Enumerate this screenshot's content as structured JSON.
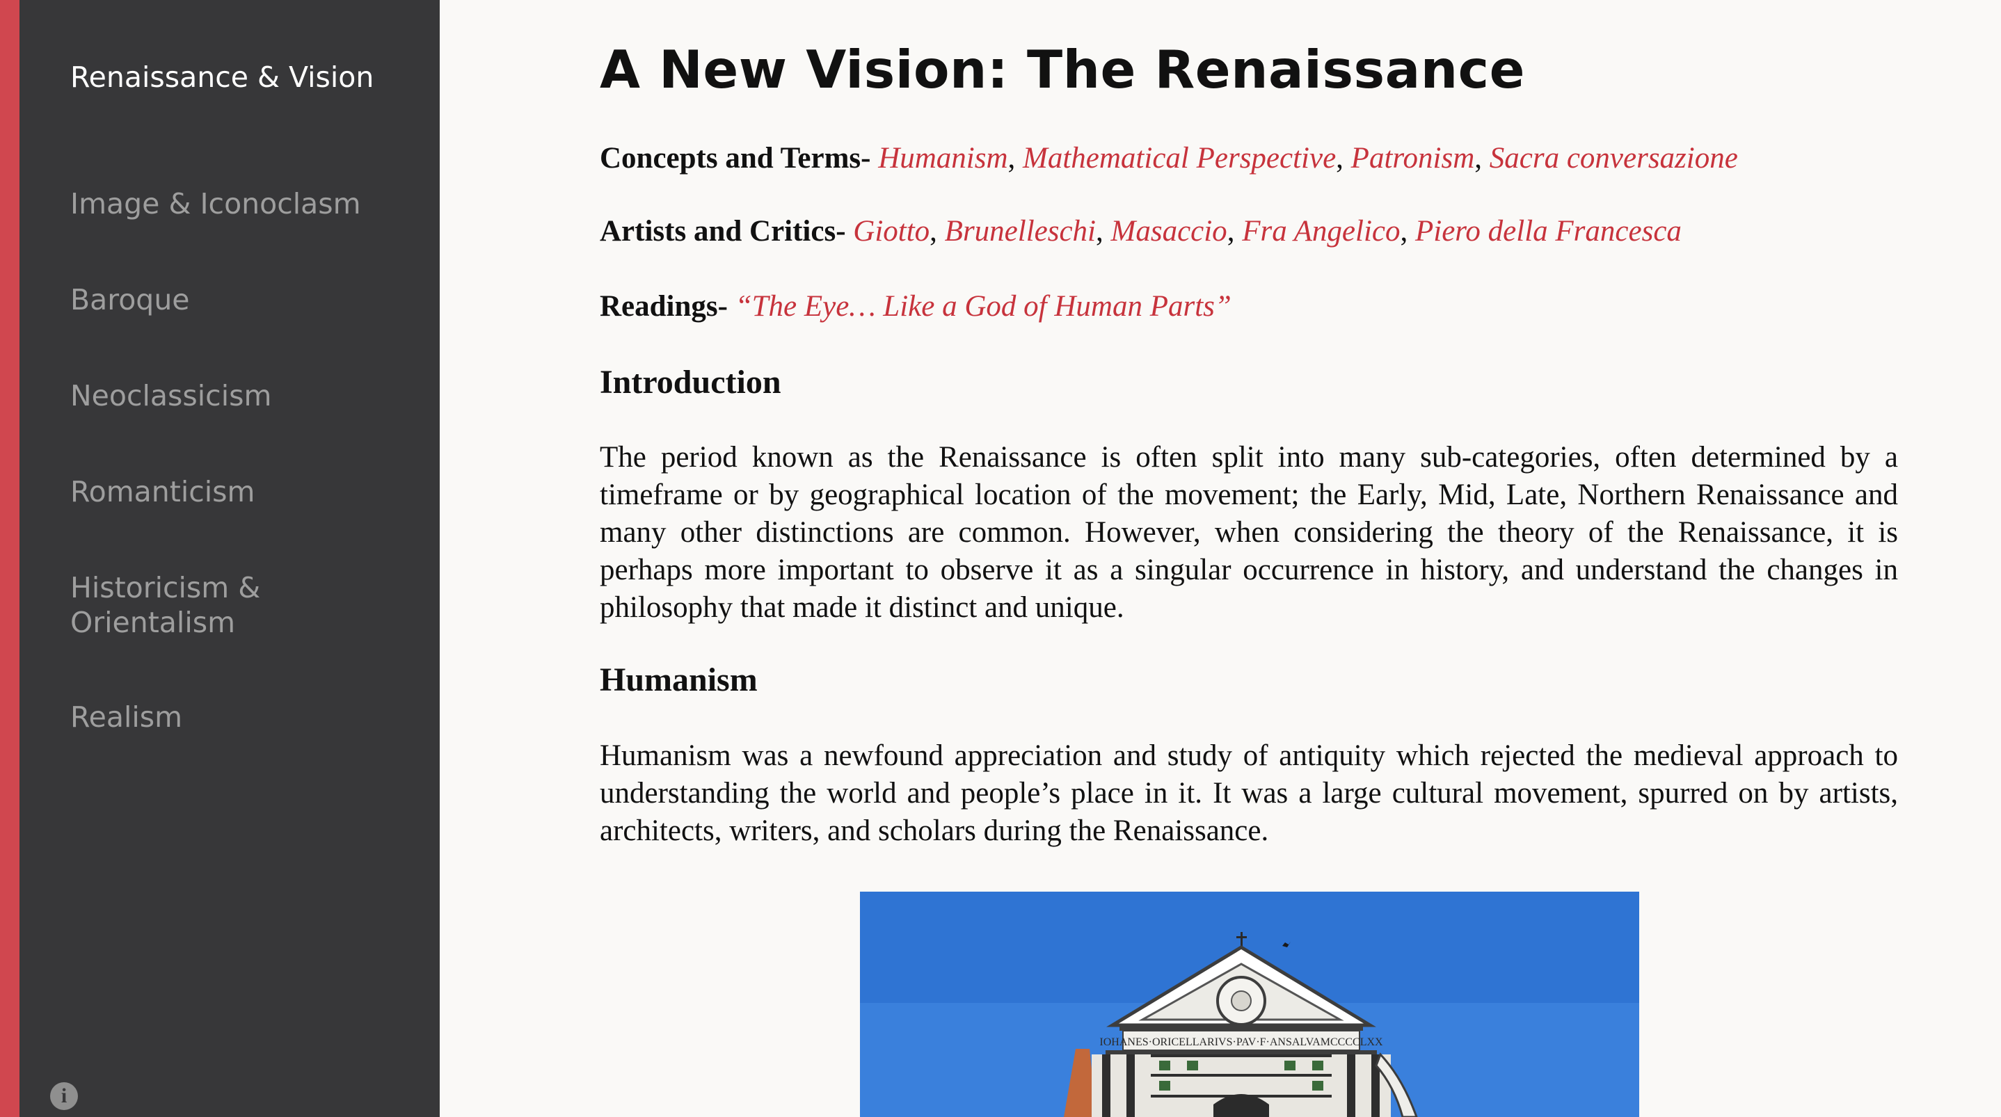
{
  "sidebar": {
    "items": [
      {
        "label": "Renaissance & Vision",
        "active": true
      },
      {
        "label": "Image & Iconoclasm"
      },
      {
        "label": "Baroque"
      },
      {
        "label": "Neoclassicism"
      },
      {
        "label": "Romanticism"
      },
      {
        "label": "Historicism &"
      },
      {
        "label": "Orientalism"
      },
      {
        "label": "Realism"
      }
    ],
    "info_icon": "info-icon"
  },
  "main": {
    "title": "A New Vision: The Renaissance",
    "concepts": {
      "label": "Concepts and Terms-",
      "links": [
        "Humanism",
        "Mathematical Perspective",
        "Patronism",
        "Sacra conversazione"
      ]
    },
    "artists": {
      "label": "Artists and Critics-",
      "links": [
        "Giotto",
        "Brunelleschi",
        "Masaccio",
        "Fra Angelico",
        "Piero della Francesca"
      ]
    },
    "readings": {
      "label": "Readings-",
      "links": [
        "“The Eye… Like a God of Human Parts”"
      ]
    },
    "separator": ",",
    "intro_heading": "Introduction",
    "intro_text": "The period known as the Renaissance is often split into many sub-categories, often determined by a timeframe or by geographical location of the movement; the Early, Mid, Late, Northern Renaissance and many other distinctions are common. However, when considering the theory of the Renaissance, it is perhaps more important to observe it as a singular occurrence in history, and understand the changes in philosophy that made it distinct and unique.",
    "humanism_heading": "Humanism",
    "humanism_text": "Humanism was a newfound appreciation and study of antiquity which rejected the medieval approach to understanding the world and people’s place in it. It was a large cultural movement, spurred on by artists, architects, writers, and scholars during the Renaissance.",
    "photo_inscription": "IOHANES·ORICELLARIVS·PAV·F·ANSALVAMCCCCLXX"
  },
  "colors": {
    "accent": "#d0474f",
    "sidebar_bg": "#373739",
    "link": "#c7333c",
    "page_bg": "#faf9f7",
    "sky": "#2f74d3"
  }
}
